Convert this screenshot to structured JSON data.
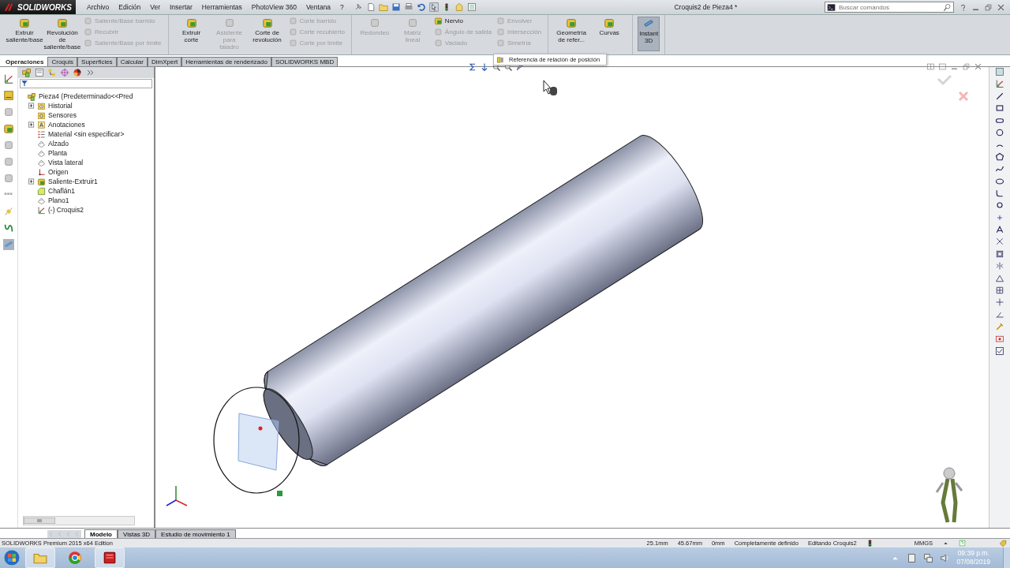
{
  "title_bar": {
    "app_name": "SOLIDWORKS",
    "menu": [
      "Archivo",
      "Edición",
      "Ver",
      "Insertar",
      "Herramientas",
      "PhotoView 360",
      "Ventana",
      "?"
    ],
    "document_title": "Croquis2 de Pieza4 *",
    "search": {
      "placeholder": "Buscar comandos"
    }
  },
  "ribbon": {
    "groups": [
      {
        "items": [
          {
            "kind": "large",
            "label": "Extruir saliente/base",
            "disabled": false
          },
          {
            "kind": "large",
            "label": "Revolución de saliente/base",
            "disabled": false
          },
          {
            "kind": "stack",
            "items": [
              {
                "label": "Saliente/Base barrido",
                "disabled": true
              },
              {
                "label": "Recubrir",
                "disabled": true
              },
              {
                "label": "Saliente/Base por límite",
                "disabled": true
              }
            ]
          }
        ]
      },
      {
        "items": [
          {
            "kind": "large",
            "label": "Extruir corte",
            "disabled": false
          },
          {
            "kind": "large",
            "label": "Asistente para taladro",
            "disabled": true
          },
          {
            "kind": "large",
            "label": "Corte de revolución",
            "disabled": false
          },
          {
            "kind": "stack",
            "items": [
              {
                "label": "Corte barrido",
                "disabled": true
              },
              {
                "label": "Corte recubierto",
                "disabled": true
              },
              {
                "label": "Corte por límite",
                "disabled": true
              }
            ]
          }
        ]
      },
      {
        "items": [
          {
            "kind": "large",
            "label": "Redondeo",
            "disabled": true
          },
          {
            "kind": "large",
            "label": "Matriz lineal",
            "disabled": true
          },
          {
            "kind": "stack",
            "items": [
              {
                "label": "Nervio",
                "disabled": false
              },
              {
                "label": "Ángulo de salida",
                "disabled": true
              },
              {
                "label": "Vaciado",
                "disabled": true
              }
            ]
          },
          {
            "kind": "stack",
            "items": [
              {
                "label": "Envolver",
                "disabled": true
              },
              {
                "label": "Intersección",
                "disabled": true
              },
              {
                "label": "Simetría",
                "disabled": true
              }
            ]
          }
        ]
      },
      {
        "items": [
          {
            "kind": "large",
            "label": "Geometría de refer...",
            "disabled": false
          },
          {
            "kind": "large",
            "label": "Curvas",
            "disabled": false
          }
        ]
      },
      {
        "items": [
          {
            "kind": "toggle",
            "label": "Instant 3D",
            "on": true
          }
        ]
      }
    ]
  },
  "command_tabs": [
    {
      "label": "Operaciones",
      "selected": true
    },
    {
      "label": "Croquis",
      "selected": false
    },
    {
      "label": "Superficies",
      "selected": false
    },
    {
      "label": "Calcular",
      "selected": false
    },
    {
      "label": "DimXpert",
      "selected": false
    },
    {
      "label": "Herramientas de renderizado",
      "selected": false
    },
    {
      "label": "SOLIDWORKS MBD",
      "selected": false
    }
  ],
  "tooltip": {
    "text": "Referencia de relación de posición"
  },
  "feature_tree": {
    "root": {
      "label": "Pieza4  (Predeterminado<<Pred",
      "kind": "part",
      "children": [
        {
          "label": "Historial",
          "kind": "history",
          "expanded": false
        },
        {
          "label": "Sensores",
          "kind": "sensor"
        },
        {
          "label": "Anotaciones",
          "kind": "annotation",
          "expanded": false
        },
        {
          "label": "Material <sin especificar>",
          "kind": "material"
        },
        {
          "label": "Alzado",
          "kind": "plane"
        },
        {
          "label": "Planta",
          "kind": "plane"
        },
        {
          "label": "Vista lateral",
          "kind": "plane"
        },
        {
          "label": "Origen",
          "kind": "origin"
        },
        {
          "label": "Saliente-Extruir1",
          "kind": "extrude",
          "expanded": false
        },
        {
          "label": "Chaflán1",
          "kind": "chamfer"
        },
        {
          "label": "Plano1",
          "kind": "plane"
        },
        {
          "label": "(-) Croquis2",
          "kind": "sketch"
        }
      ]
    }
  },
  "bottom_tabs": [
    {
      "label": "Modelo",
      "selected": true
    },
    {
      "label": "Vistas 3D",
      "selected": false
    },
    {
      "label": "Estudio de movimiento 1",
      "selected": false
    }
  ],
  "status_bar": {
    "edition": "SOLIDWORKS Premium 2015 x64 Edition",
    "readouts": [
      "25.1mm",
      "45.67mm",
      "0mm"
    ],
    "state": "Completamente definido",
    "editing": "Editando Croquis2",
    "units": "MMGS"
  },
  "taskbar": {
    "time": "09:39 p.m.",
    "date": "07/08/2019"
  }
}
